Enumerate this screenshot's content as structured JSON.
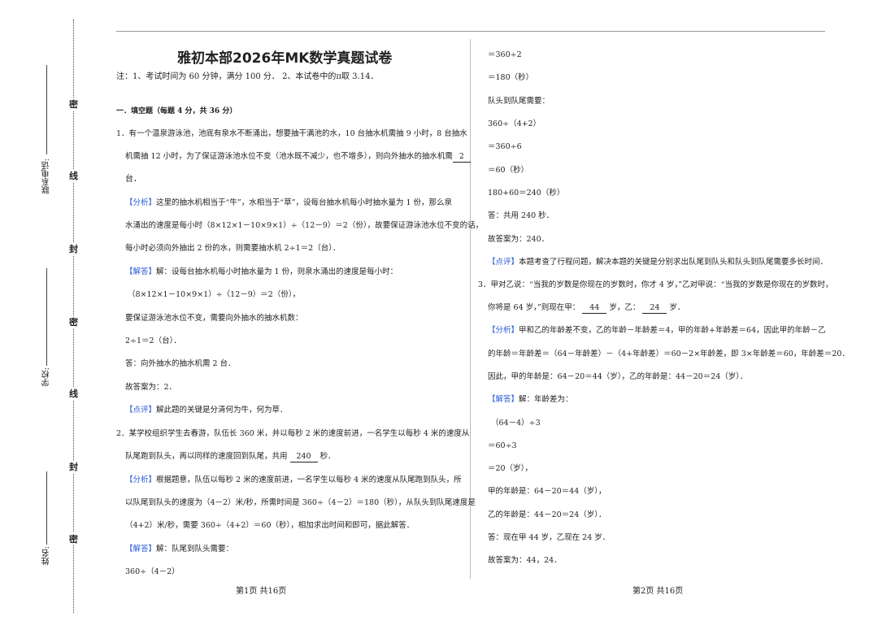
{
  "binding": {
    "contact_label": "联系电话:",
    "school_label": "学校:",
    "name_label": "姓名:",
    "seal_chars": [
      "密",
      "线",
      "封",
      "密",
      "线",
      "封",
      "密"
    ]
  },
  "page1": {
    "title": "雅初本部2026年MK数学真题试卷",
    "note": "注：1、考试时间为 60 分钟，满分 100 分．   2、本试卷中的π取 3.14．",
    "section": "一．填空题（每题 4 分，共 36 分）",
    "q1_line1": "1．有一个温泉游泳池，池底有泉水不断涌出，想要抽干满池的水，10 台抽水机需抽 9 小时，8 台抽水",
    "q1_line2_pre": "机需抽 12 小时，为了保证游泳池水位不变（池水既不减少，也不增多），则向外抽水的抽水机需",
    "q1_answer": "2",
    "q1_line3": "台．",
    "q1_analysis_tag": "【分析】",
    "q1_analysis_1": "这里的抽水机相当于“牛”，水相当于“草”，设每台抽水机每小时抽水量为 1 份，那么泉",
    "q1_analysis_2": "水涌出的速度是每小时（8×12×1－10×9×1）÷（12－9）＝2（份），故要保证游泳池水位不变的话，",
    "q1_analysis_3": "每小时必须向外抽出 2 份的水，则需要抽水机 2÷1＝2（台）．",
    "q1_solution_tag": "【解答】",
    "q1_solution_1": "解：设每台抽水机每小时抽水量为 1 份，则泉水涌出的速度是每小时：",
    "q1_solution_2": "（8×12×1－10×9×1）÷（12－9）＝2（份），",
    "q1_solution_3": "要保证游泳池水位不变，需要向外抽水的抽水机数：",
    "q1_solution_4": "2÷1＝2（台）．",
    "q1_solution_5": "答：向外抽水的抽水机需 2 台．",
    "q1_final": "故答案为：2．",
    "q1_comment_tag": "【点评】",
    "q1_comment": "解此题的关键是分清何为牛，何为草．",
    "q2_line1": "2．某学校组织学生去春游，队伍长 360 米，并以每秒 2 米的速度前进，一名学生以每秒 4 米的速度从",
    "q2_line2_pre": "队尾跑到队头，再以同样的速度回到队尾，共用",
    "q2_answer": "240",
    "q2_line2_post": "秒．",
    "q2_analysis_tag": "【分析】",
    "q2_analysis_1": "根据题意，队伍以每秒 2 米的速度前进，一名学生以每秒 4 米的速度从队尾跑到队头，所",
    "q2_analysis_2": "以队尾到队头的速度为（4－2）米/秒，所需时间是 360÷（4－2）＝180（秒），从队头到队尾速度是",
    "q2_analysis_3": "（4+2）米/秒，需要 360÷（4+2）＝60（秒），相加求出时间和即可，据此解答．",
    "q2_solution_tag": "【解答】",
    "q2_solution_1": "解：队尾到队头需要：",
    "q2_solution_2": "360÷（4－2）",
    "footer": "第1页 共16页"
  },
  "page2": {
    "l1": "＝360÷2",
    "l2": "＝180（秒）",
    "l3": "队头到队尾需要：",
    "l4": "360÷（4+2）",
    "l5": "＝360÷6",
    "l6": "＝60（秒）",
    "l7": "180+60＝240（秒）",
    "l8": "答：共用 240 秒．",
    "l9": "故答案为：240．",
    "comment_tag": "【点评】",
    "comment": "本题考查了行程问题，解决本题的关键是分别求出队尾到队头和队头到队尾需要多长时间．",
    "q3_line1": "3．甲对乙说：“当我的岁数是你现在的岁数时，你才 4 岁，”乙对甲说：“当我的岁数是你现在的岁数时，",
    "q3_line2_pre": "你将是 64 岁，”则现在甲：",
    "q3_answer_a": "44",
    "q3_line2_mid": "岁，乙：",
    "q3_answer_b": "24",
    "q3_line2_post": "岁．",
    "q3_analysis_tag": "【分析】",
    "q3_analysis_1": "甲和乙的年龄差不变，乙的年龄－年龄差＝4，甲的年龄+年龄差＝64，因此甲的年龄－乙",
    "q3_analysis_2": "的年龄＝年龄差＝（64－年龄差）－（4+年龄差）＝60－2×年龄差，即 3×年龄差＝60，年龄差＝20．",
    "q3_analysis_3": "因此，甲的年龄是：64－20＝44（岁），乙的年龄是：44－20＝24（岁）．",
    "q3_solution_tag": "【解答】",
    "q3_solution_1": "解：年龄差为：",
    "q3_solution_2": "（64－4）÷3",
    "q3_solution_3": "＝60÷3",
    "q3_solution_4": "＝20（岁），",
    "q3_solution_5": "甲的年龄是：64－20＝44（岁），",
    "q3_solution_6": "乙的年龄是：44－20＝24（岁）．",
    "q3_solution_7": "答：现在甲 44 岁，乙现在 24 岁．",
    "q3_final": "故答案为：44，24．",
    "footer": "第2页 共16页"
  }
}
